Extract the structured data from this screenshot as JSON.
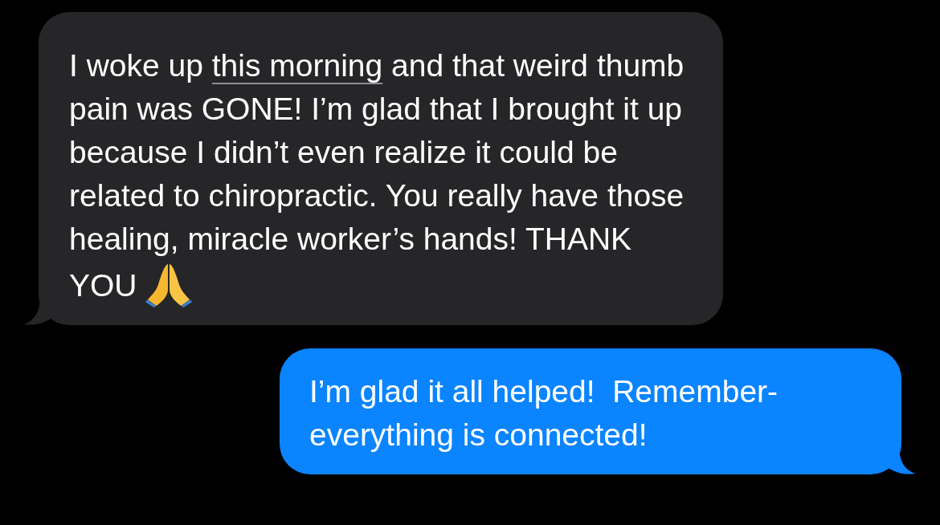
{
  "messages": [
    {
      "kind": "incoming",
      "segments": [
        {
          "kind": "text",
          "text": "I woke up "
        },
        {
          "kind": "link",
          "text": "this morning"
        },
        {
          "kind": "text",
          "text": " and that weird thumb pain was GONE! I’m glad that I brought it up because I didn’t even realize it could be related to chiropractic. You really have those healing, miracle worker’s hands! THANK YOU "
        },
        {
          "kind": "emoji"
        }
      ]
    },
    {
      "kind": "outgoing",
      "segments": [
        {
          "kind": "text",
          "text": "I’m glad it all helped!  Remember-everything is connected!"
        }
      ]
    }
  ]
}
